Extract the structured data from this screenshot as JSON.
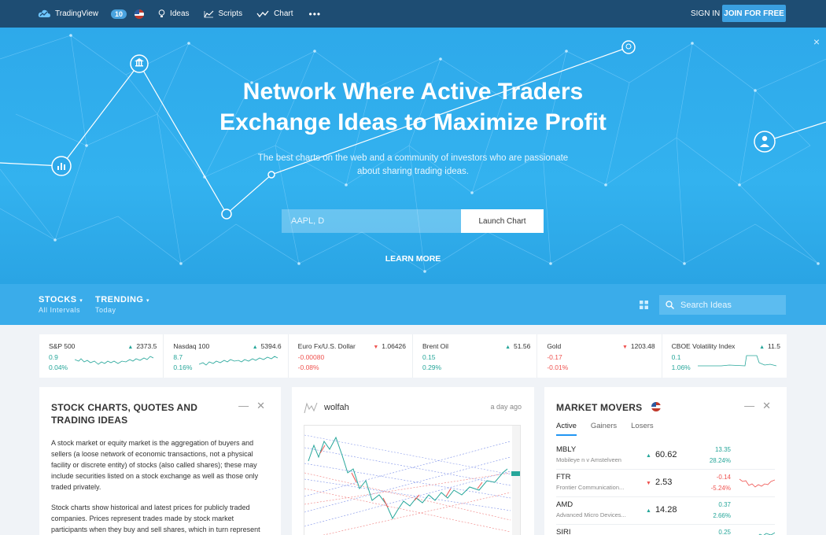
{
  "nav": {
    "brand": "TradingView",
    "badge": "10",
    "items": [
      "Ideas",
      "Scripts",
      "Chart"
    ],
    "more": "•••",
    "signin": "SIGN IN",
    "join": "JOIN FOR FREE"
  },
  "hero": {
    "title_line1": "Network Where Active Traders",
    "title_line2": "Exchange Ideas to Maximize Profit",
    "subtitle_line1": "The best charts on the web and a community of investors who are passionate",
    "subtitle_line2": "about sharing trading ideas.",
    "search_value": "AAPL, D",
    "launch_label": "Launch Chart",
    "learn_more": "LEARN MORE",
    "close": "×"
  },
  "filters": {
    "stocks": "STOCKS",
    "stocks_sub": "All Intervals",
    "trending": "TRENDING",
    "trending_sub": "Today",
    "search_placeholder": "Search Ideas"
  },
  "tickers": [
    {
      "name": "S&P 500",
      "price": "2373.5",
      "dir": "up",
      "change": "0.9",
      "pct": "0.04%"
    },
    {
      "name": "Nasdaq 100",
      "price": "5394.6",
      "dir": "up",
      "change": "8.7",
      "pct": "0.16%"
    },
    {
      "name": "Euro Fx/U.S. Dollar",
      "price": "1.06426",
      "dir": "down",
      "change": "-0.00080",
      "pct": "-0.08%"
    },
    {
      "name": "Brent Oil",
      "price": "51.56",
      "dir": "up",
      "change": "0.15",
      "pct": "0.29%"
    },
    {
      "name": "Gold",
      "price": "1203.48",
      "dir": "down",
      "change": "-0.17",
      "pct": "-0.01%"
    },
    {
      "name": "CBOE Volatility Index",
      "price": "11.5",
      "dir": "up",
      "change": "0.1",
      "pct": "1.06%"
    }
  ],
  "card_info": {
    "title": "STOCK CHARTS, QUOTES AND TRADING IDEAS",
    "p1": "A stock market or equity market is the aggregation of buyers and sellers (a loose network of economic transactions, not a physical facility or discrete entity) of stocks (also called shares); these may include securities listed on a stock exchange as well as those only traded privately.",
    "p2": "Stock charts show historical and latest prices for publicly traded companies. Prices represent trades made by stock market participants when they buy and sell shares, which in turn represent"
  },
  "card_idea": {
    "author": "wolfah",
    "time": "a day ago"
  },
  "movers": {
    "title": "MARKET MOVERS",
    "tabs": [
      "Active",
      "Gainers",
      "Losers"
    ],
    "rows": [
      {
        "sym": "MBLY",
        "desc": "Mobileye n v Amstelveen",
        "price": "60.62",
        "dir": "up",
        "chg": "13.35",
        "pct": "28.24%"
      },
      {
        "sym": "FTR",
        "desc": "Frontier Communication...",
        "price": "2.53",
        "dir": "down",
        "chg": "-0.14",
        "pct": "-5.24%"
      },
      {
        "sym": "AMD",
        "desc": "Advanced Micro Devices...",
        "price": "14.28",
        "dir": "up",
        "chg": "0.37",
        "pct": "2.66%"
      },
      {
        "sym": "SIRI",
        "desc": "",
        "price": "",
        "dir": "up",
        "chg": "0.25",
        "pct": ""
      }
    ]
  },
  "colors": {
    "nav": "#1e4d73",
    "hero": "#2ea9ea",
    "up": "#26a69a",
    "down": "#ef5350",
    "accent": "#2196f3"
  }
}
